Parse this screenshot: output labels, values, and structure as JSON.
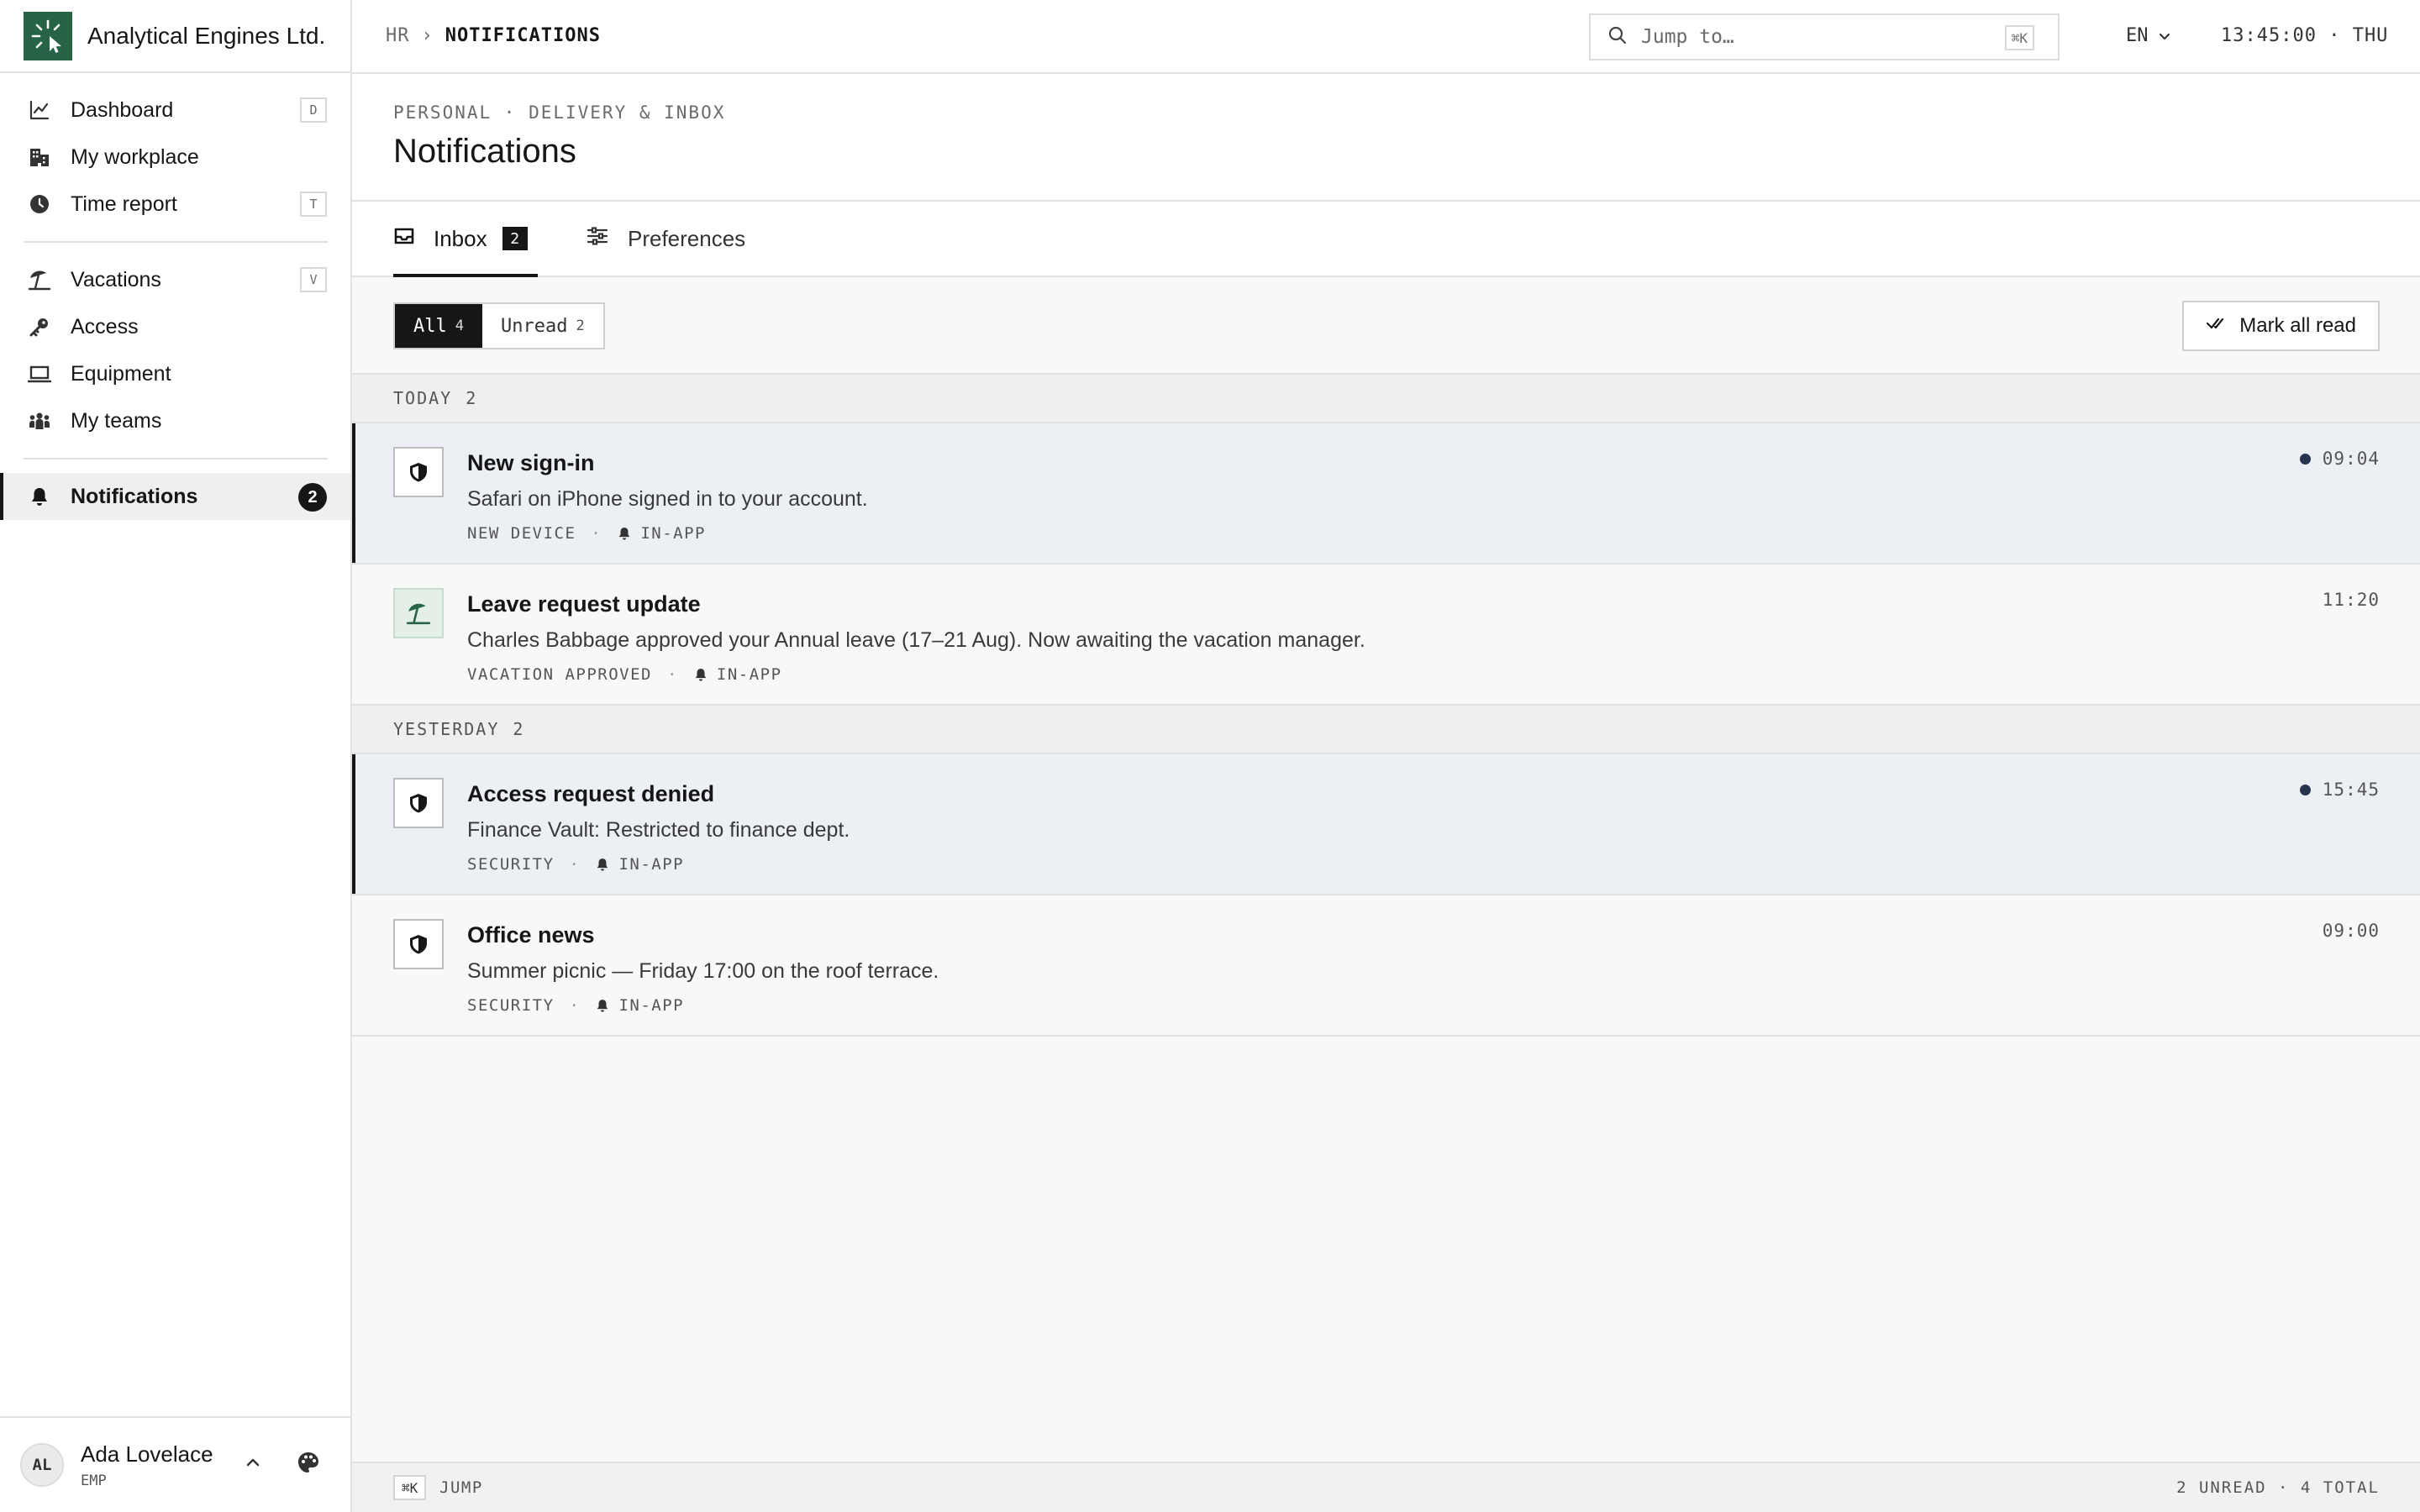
{
  "brand": {
    "name": "Analytical Engines Ltd."
  },
  "sidebar": {
    "items": [
      {
        "label": "Dashboard",
        "shortcut": "D",
        "icon": "chart-line-icon"
      },
      {
        "label": "My workplace",
        "icon": "building-icon"
      },
      {
        "label": "Time report",
        "shortcut": "T",
        "icon": "clock-icon"
      },
      {
        "label": "Vacations",
        "shortcut": "V",
        "icon": "umbrella-beach-icon"
      },
      {
        "label": "Access",
        "icon": "key-icon"
      },
      {
        "label": "Equipment",
        "icon": "laptop-icon"
      },
      {
        "label": "My teams",
        "icon": "people-icon"
      },
      {
        "label": "Notifications",
        "badge": "2",
        "icon": "bell-icon",
        "active": true
      }
    ]
  },
  "user": {
    "initials": "AL",
    "name": "Ada Lovelace",
    "role": "EMP"
  },
  "topbar": {
    "breadcrumb_root": "HR",
    "breadcrumb_sep": "›",
    "breadcrumb_current": "NOTIFICATIONS",
    "search_placeholder": "Jump to…",
    "search_shortcut": "⌘K",
    "language": "EN",
    "clock": "13:45:00 · THU"
  },
  "page": {
    "eyebrow": "PERSONAL · DELIVERY & INBOX",
    "title": "Notifications"
  },
  "tabs": [
    {
      "label": "Inbox",
      "badge": "2",
      "active": true
    },
    {
      "label": "Preferences"
    }
  ],
  "filters": {
    "all_label": "All",
    "all_count": "4",
    "unread_label": "Unread",
    "unread_count": "2",
    "mark_all": "Mark all read"
  },
  "groups": [
    {
      "label": "TODAY",
      "count": "2"
    },
    {
      "label": "YESTERDAY",
      "count": "2"
    }
  ],
  "notifications": [
    {
      "title": "New sign-in",
      "body": "Safari on iPhone signed in to your account.",
      "category": "NEW DEVICE",
      "channel": "IN-APP",
      "time": "09:04",
      "unread": true,
      "icon": "shield-icon"
    },
    {
      "title": "Leave request update",
      "body": "Charles Babbage approved your Annual leave (17–21 Aug). Now awaiting the vacation manager.",
      "category": "VACATION APPROVED",
      "channel": "IN-APP",
      "time": "11:20",
      "unread": false,
      "icon": "umbrella-beach-icon"
    },
    {
      "title": "Access request denied",
      "body": "Finance Vault: Restricted to finance dept.",
      "category": "SECURITY",
      "channel": "IN-APP",
      "time": "15:45",
      "unread": true,
      "icon": "shield-icon"
    },
    {
      "title": "Office news",
      "body": "Summer picnic — Friday 17:00 on the roof terrace.",
      "category": "SECURITY",
      "channel": "IN-APP",
      "time": "09:00",
      "unread": false,
      "icon": "shield-icon"
    }
  ],
  "footer": {
    "shortcut": "⌘K",
    "jump_label": "JUMP",
    "stats": "2 UNREAD · 4 TOTAL"
  },
  "colors": {
    "brand": "#276446",
    "ink": "#161616",
    "unread_row": "#eceff4",
    "unread_dot": "#26344f"
  }
}
